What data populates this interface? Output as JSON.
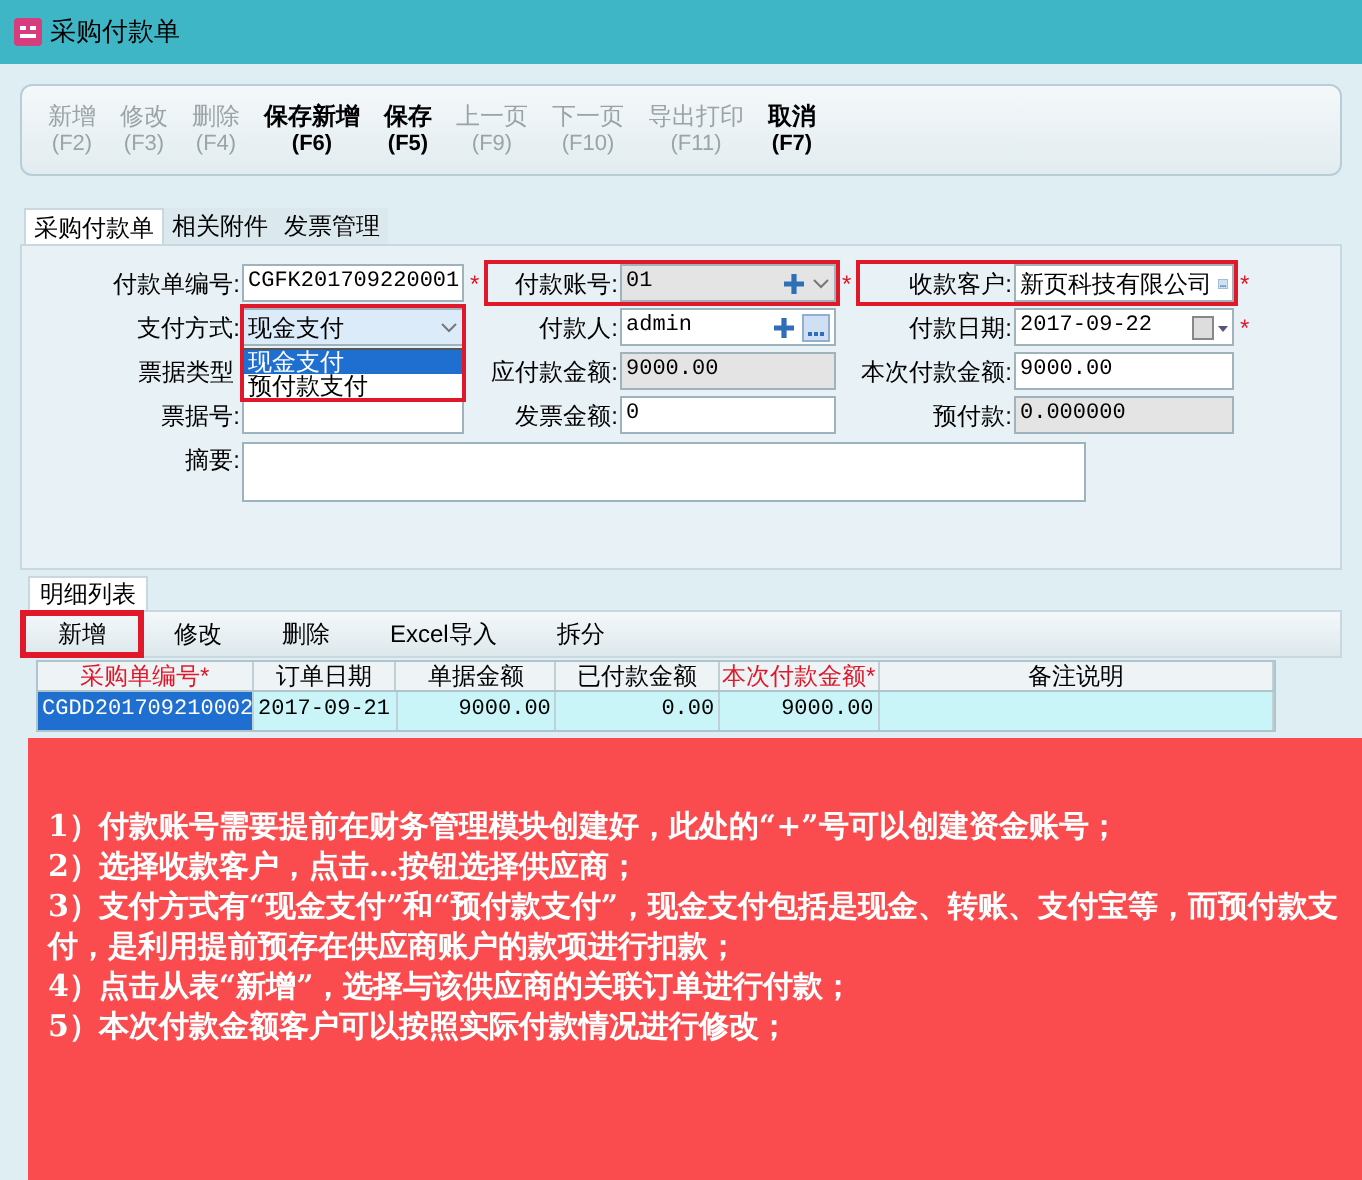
{
  "window": {
    "title": "采购付款单"
  },
  "toolbar": [
    {
      "label": "新增",
      "key": "(F2)",
      "disabled": true
    },
    {
      "label": "修改",
      "key": "(F3)",
      "disabled": true
    },
    {
      "label": "删除",
      "key": "(F4)",
      "disabled": true
    },
    {
      "label": "保存新增",
      "key": "(F6)",
      "disabled": false
    },
    {
      "label": "保存",
      "key": "(F5)",
      "disabled": false
    },
    {
      "label": "上一页",
      "key": "(F9)",
      "disabled": true
    },
    {
      "label": "下一页",
      "key": "(F10)",
      "disabled": true
    },
    {
      "label": "导出打印",
      "key": "(F11)",
      "disabled": true
    },
    {
      "label": "取消",
      "key": "(F7)",
      "disabled": false
    }
  ],
  "tabs": [
    {
      "label": "采购付款单",
      "selected": true
    },
    {
      "label": "相关附件",
      "selected": false
    },
    {
      "label": "发票管理",
      "selected": false
    }
  ],
  "form": {
    "rows": [
      [
        {
          "label": "付款单编号:",
          "value": "CGFK201709220001",
          "kind": "text",
          "mark": "*",
          "readonly": false,
          "highlighted": false
        },
        {
          "label": "付款账号:",
          "value": "01",
          "kind": "account",
          "mark": "*",
          "readonly": true,
          "highlighted": true
        },
        {
          "label": "收款客户:",
          "value": "新页科技有限公司",
          "kind": "lookup",
          "mark": "*",
          "readonly": false,
          "highlighted": true
        }
      ],
      [
        {
          "label": "支付方式:",
          "value": "现金支付",
          "kind": "select",
          "readonly": false,
          "highlighted": true,
          "options": [
            {
              "label": "现金支付",
              "selected": true
            },
            {
              "label": "预付款支付",
              "selected": false
            }
          ]
        },
        {
          "label": "付款人:",
          "value": "admin",
          "kind": "account",
          "readonly": false,
          "highlighted": false
        },
        {
          "label": "付款日期:",
          "value": "2017-09-22",
          "kind": "date",
          "mark": "*",
          "readonly": false,
          "highlighted": false
        }
      ],
      [
        {
          "label": "票据类型",
          "kind": "covered"
        },
        {
          "label": "应付款金额:",
          "value": "9000.00",
          "kind": "text",
          "readonly": true,
          "highlighted": false
        },
        {
          "label": "本次付款金额:",
          "value": "9000.00",
          "kind": "text",
          "readonly": false,
          "highlighted": false
        }
      ],
      [
        {
          "label": "票据号:",
          "kind": "text",
          "readonly": false,
          "highlighted": false
        },
        {
          "label": "发票金额:",
          "value": "0",
          "kind": "text",
          "readonly": false,
          "highlighted": false
        },
        {
          "label": "预付款:",
          "value": "0.000000",
          "kind": "text",
          "readonly": true,
          "highlighted": false
        }
      ]
    ],
    "summary": {
      "label": "摘要:"
    }
  },
  "detail": {
    "tab": "明细列表",
    "buttons": [
      {
        "label": "新增",
        "highlighted": true
      },
      {
        "label": "修改",
        "highlighted": false
      },
      {
        "label": "删除",
        "highlighted": false
      },
      {
        "label": "Excel导入",
        "highlighted": false
      },
      {
        "label": "拆分",
        "highlighted": false
      }
    ],
    "columns": [
      {
        "label": "采购单编号*",
        "required": true
      },
      {
        "label": "订单日期",
        "required": false
      },
      {
        "label": "单据金额",
        "required": false
      },
      {
        "label": "已付款金额",
        "required": false
      },
      {
        "label": "本次付款金额*",
        "required": true
      },
      {
        "label": "备注说明",
        "required": false
      }
    ],
    "rows": [
      {
        "selected": true,
        "cells": [
          "CGDD201709210002",
          "2017-09-21",
          "9000.00",
          "0.00",
          "9000.00",
          null
        ]
      }
    ]
  },
  "annotation": [
    "1）付款账号需要提前在财务管理模块创建好，此处的“+”号可以创建资金账号；",
    "2）选择收款客户，点击…按钮选择供应商；",
    "3）支付方式有“现金支付”和“预付款支付”，现金支付包括是现金、转账、支付宝等，而预付款支付，是利用提前预存在供应商账户的款项进行扣款；",
    "4）点击从表“新增”，选择与该供应商的关联订单进行付款；",
    "5）本次付款金额客户可以按照实际付款情况进行修改；"
  ]
}
